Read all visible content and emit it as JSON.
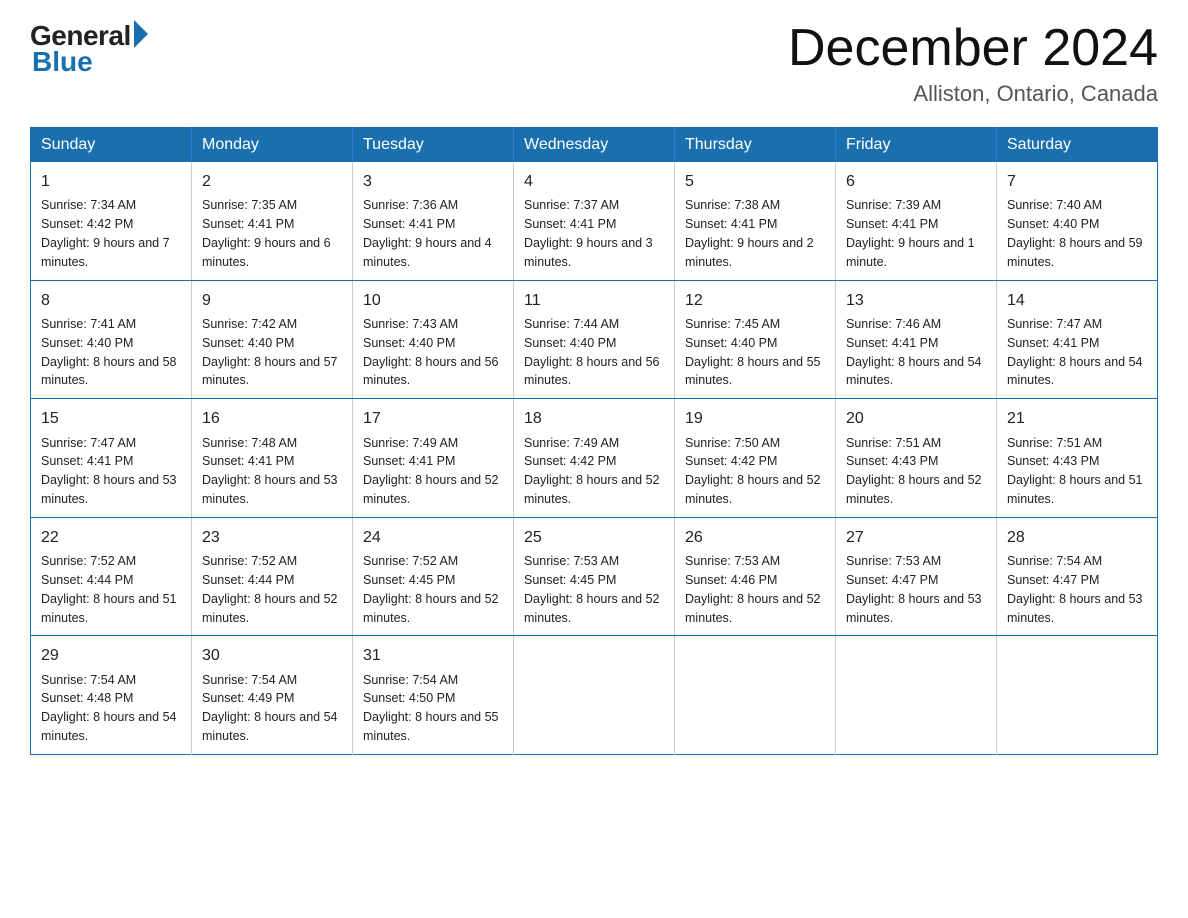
{
  "logo": {
    "general": "General",
    "blue": "Blue"
  },
  "title": {
    "month_year": "December 2024",
    "location": "Alliston, Ontario, Canada"
  },
  "days_of_week": [
    "Sunday",
    "Monday",
    "Tuesday",
    "Wednesday",
    "Thursday",
    "Friday",
    "Saturday"
  ],
  "weeks": [
    [
      {
        "day": "1",
        "sunrise": "7:34 AM",
        "sunset": "4:42 PM",
        "daylight": "9 hours and 7 minutes."
      },
      {
        "day": "2",
        "sunrise": "7:35 AM",
        "sunset": "4:41 PM",
        "daylight": "9 hours and 6 minutes."
      },
      {
        "day": "3",
        "sunrise": "7:36 AM",
        "sunset": "4:41 PM",
        "daylight": "9 hours and 4 minutes."
      },
      {
        "day": "4",
        "sunrise": "7:37 AM",
        "sunset": "4:41 PM",
        "daylight": "9 hours and 3 minutes."
      },
      {
        "day": "5",
        "sunrise": "7:38 AM",
        "sunset": "4:41 PM",
        "daylight": "9 hours and 2 minutes."
      },
      {
        "day": "6",
        "sunrise": "7:39 AM",
        "sunset": "4:41 PM",
        "daylight": "9 hours and 1 minute."
      },
      {
        "day": "7",
        "sunrise": "7:40 AM",
        "sunset": "4:40 PM",
        "daylight": "8 hours and 59 minutes."
      }
    ],
    [
      {
        "day": "8",
        "sunrise": "7:41 AM",
        "sunset": "4:40 PM",
        "daylight": "8 hours and 58 minutes."
      },
      {
        "day": "9",
        "sunrise": "7:42 AM",
        "sunset": "4:40 PM",
        "daylight": "8 hours and 57 minutes."
      },
      {
        "day": "10",
        "sunrise": "7:43 AM",
        "sunset": "4:40 PM",
        "daylight": "8 hours and 56 minutes."
      },
      {
        "day": "11",
        "sunrise": "7:44 AM",
        "sunset": "4:40 PM",
        "daylight": "8 hours and 56 minutes."
      },
      {
        "day": "12",
        "sunrise": "7:45 AM",
        "sunset": "4:40 PM",
        "daylight": "8 hours and 55 minutes."
      },
      {
        "day": "13",
        "sunrise": "7:46 AM",
        "sunset": "4:41 PM",
        "daylight": "8 hours and 54 minutes."
      },
      {
        "day": "14",
        "sunrise": "7:47 AM",
        "sunset": "4:41 PM",
        "daylight": "8 hours and 54 minutes."
      }
    ],
    [
      {
        "day": "15",
        "sunrise": "7:47 AM",
        "sunset": "4:41 PM",
        "daylight": "8 hours and 53 minutes."
      },
      {
        "day": "16",
        "sunrise": "7:48 AM",
        "sunset": "4:41 PM",
        "daylight": "8 hours and 53 minutes."
      },
      {
        "day": "17",
        "sunrise": "7:49 AM",
        "sunset": "4:41 PM",
        "daylight": "8 hours and 52 minutes."
      },
      {
        "day": "18",
        "sunrise": "7:49 AM",
        "sunset": "4:42 PM",
        "daylight": "8 hours and 52 minutes."
      },
      {
        "day": "19",
        "sunrise": "7:50 AM",
        "sunset": "4:42 PM",
        "daylight": "8 hours and 52 minutes."
      },
      {
        "day": "20",
        "sunrise": "7:51 AM",
        "sunset": "4:43 PM",
        "daylight": "8 hours and 52 minutes."
      },
      {
        "day": "21",
        "sunrise": "7:51 AM",
        "sunset": "4:43 PM",
        "daylight": "8 hours and 51 minutes."
      }
    ],
    [
      {
        "day": "22",
        "sunrise": "7:52 AM",
        "sunset": "4:44 PM",
        "daylight": "8 hours and 51 minutes."
      },
      {
        "day": "23",
        "sunrise": "7:52 AM",
        "sunset": "4:44 PM",
        "daylight": "8 hours and 52 minutes."
      },
      {
        "day": "24",
        "sunrise": "7:52 AM",
        "sunset": "4:45 PM",
        "daylight": "8 hours and 52 minutes."
      },
      {
        "day": "25",
        "sunrise": "7:53 AM",
        "sunset": "4:45 PM",
        "daylight": "8 hours and 52 minutes."
      },
      {
        "day": "26",
        "sunrise": "7:53 AM",
        "sunset": "4:46 PM",
        "daylight": "8 hours and 52 minutes."
      },
      {
        "day": "27",
        "sunrise": "7:53 AM",
        "sunset": "4:47 PM",
        "daylight": "8 hours and 53 minutes."
      },
      {
        "day": "28",
        "sunrise": "7:54 AM",
        "sunset": "4:47 PM",
        "daylight": "8 hours and 53 minutes."
      }
    ],
    [
      {
        "day": "29",
        "sunrise": "7:54 AM",
        "sunset": "4:48 PM",
        "daylight": "8 hours and 54 minutes."
      },
      {
        "day": "30",
        "sunrise": "7:54 AM",
        "sunset": "4:49 PM",
        "daylight": "8 hours and 54 minutes."
      },
      {
        "day": "31",
        "sunrise": "7:54 AM",
        "sunset": "4:50 PM",
        "daylight": "8 hours and 55 minutes."
      },
      null,
      null,
      null,
      null
    ]
  ]
}
